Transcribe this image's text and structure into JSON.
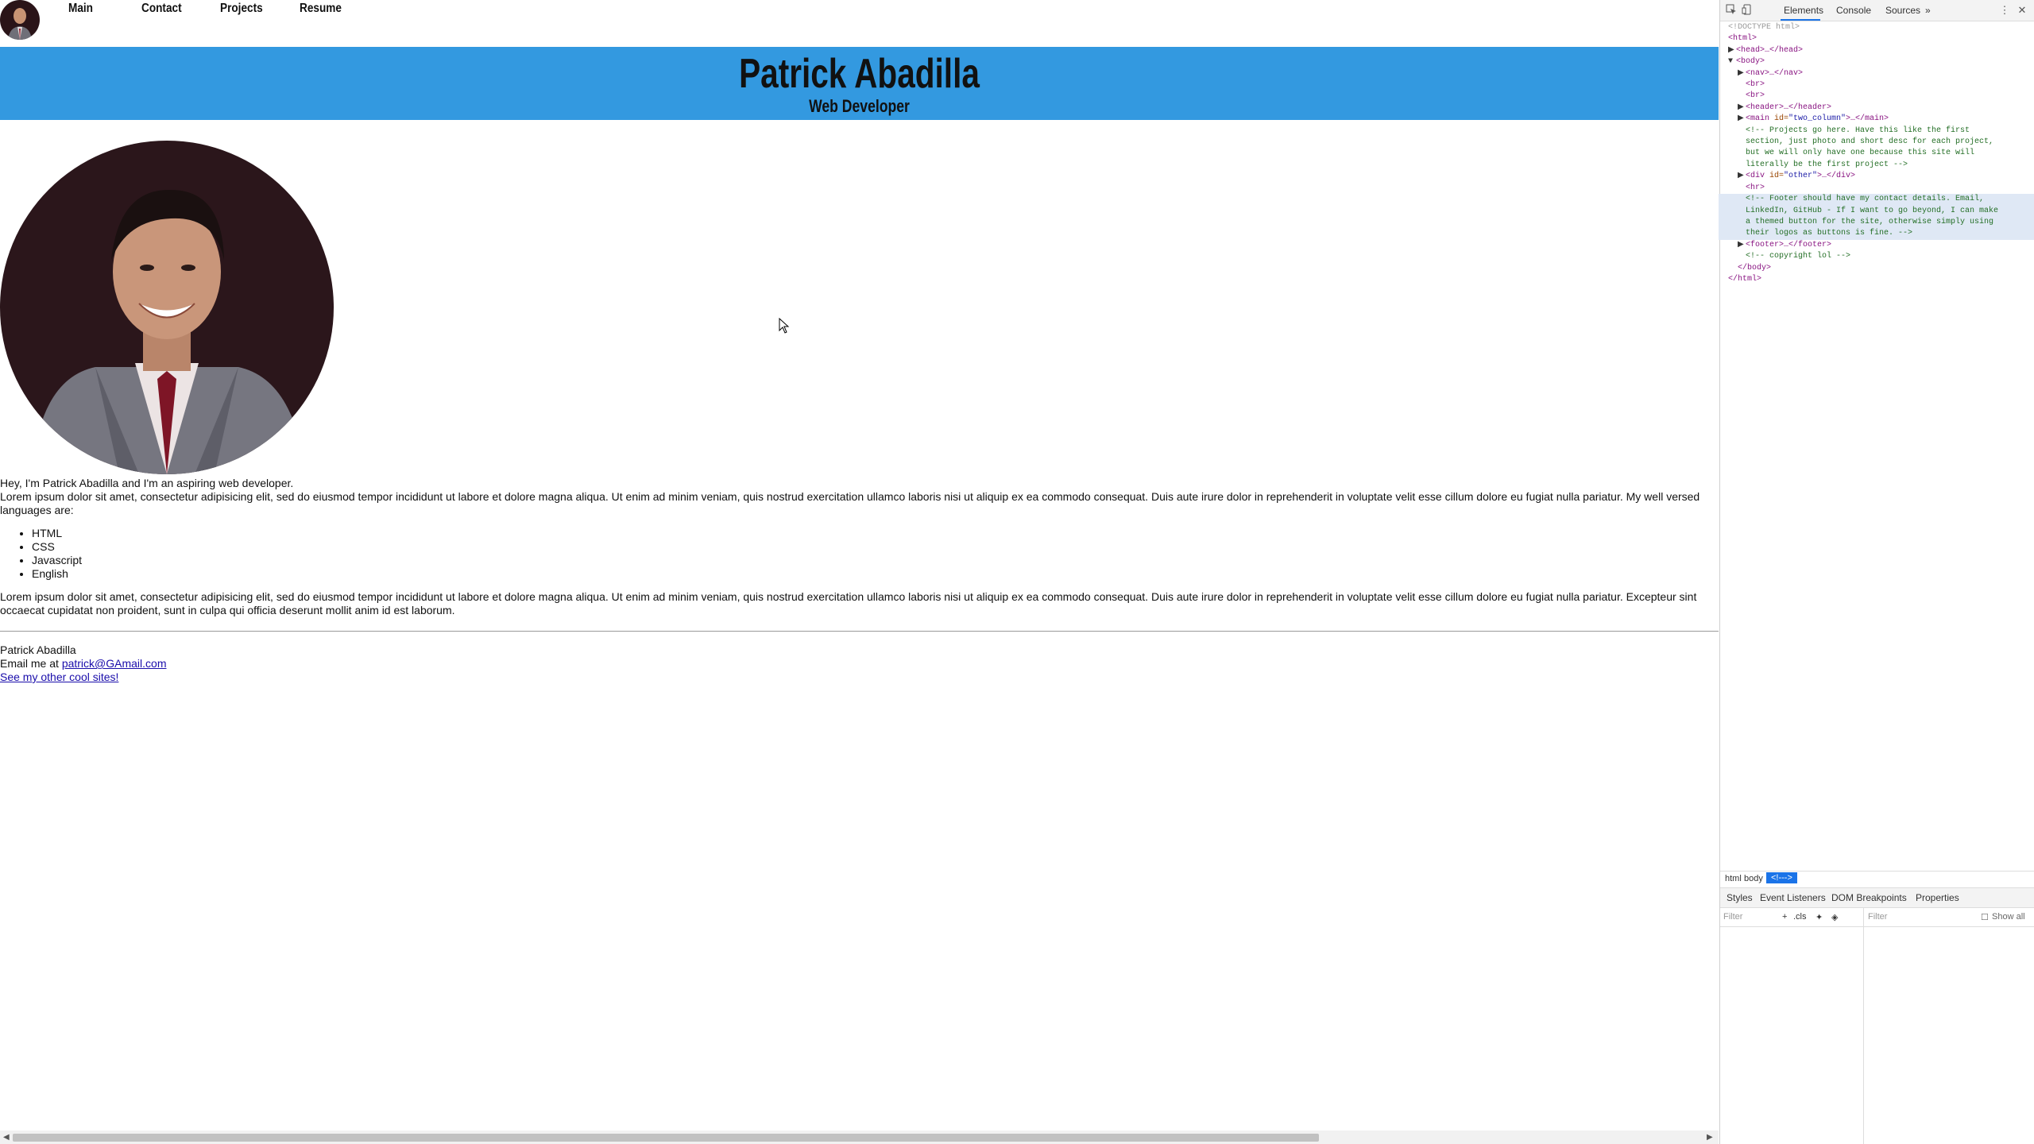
{
  "nav": {
    "links": [
      "Main",
      "Contact",
      "Projects",
      "Resume"
    ]
  },
  "header": {
    "title": "Patrick Abadilla",
    "subtitle": "Web Developer"
  },
  "intro": {
    "greeting": "Hey, I'm Patrick Abadilla and I'm an aspiring web developer.",
    "paragraph1": "Lorem ipsum dolor sit amet, consectetur adipisicing elit, sed do eiusmod tempor incididunt ut labore et dolore magna aliqua. Ut enim ad minim veniam, quis nostrud exercitation ullamco laboris nisi ut aliquip ex ea commodo consequat. Duis aute irure dolor in reprehenderit in voluptate velit esse cillum dolore eu fugiat nulla pariatur. My well versed languages are:",
    "languages": [
      "HTML",
      "CSS",
      "Javascript",
      "English"
    ],
    "paragraph2": "Lorem ipsum dolor sit amet, consectetur adipisicing elit, sed do eiusmod tempor incididunt ut labore et dolore magna aliqua. Ut enim ad minim veniam, quis nostrud exercitation ullamco laboris nisi ut aliquip ex ea commodo consequat. Duis aute irure dolor in reprehenderit in voluptate velit esse cillum dolore eu fugiat nulla pariatur. Excepteur sint occaecat cupidatat non proident, sunt in culpa qui officia deserunt mollit anim id est laborum."
  },
  "footer": {
    "name": "Patrick Abadilla",
    "email_prefix": "Email me at ",
    "email": "patrick@GAmail.com",
    "other_sites": "See my other cool sites!"
  },
  "devtools": {
    "tabs": [
      "Elements",
      "Console",
      "Sources",
      "»"
    ],
    "dom": {
      "doctype": "<!DOCTYPE html>",
      "html_open": "<html>",
      "head": "<head>…</head>",
      "body_open": "<body>",
      "nav": "<nav>…</nav>",
      "br": "<br>",
      "header": "<header>…</header>",
      "main_open": "<main ",
      "main_attr": "id=",
      "main_val": "\"two_column\"",
      "main_close": ">…</main>",
      "comment1": "<!-- Projects go here. Have this like the first\nsection, just photo and short desc for each project,\nbut we will only have one because this site will\nliterally be the first project -->",
      "div_open": "<div ",
      "div_attr": "id=",
      "div_val": "\"other\"",
      "div_close": ">…</div>",
      "hr": "<hr>",
      "comment2": "<!-- Footer should have my contact details. Email,\nLinkedIn, GitHub - If I want to go beyond, I can make\na themed button for the site, otherwise simply using\ntheir logos as buttons is fine. -->",
      "footer": "<footer>…</footer>",
      "comment3": "<!-- copyright lol -->",
      "body_close": "</body>",
      "html_close": "</html>"
    },
    "breadcrumbs": [
      "html",
      "body",
      "<!--->"
    ],
    "subtabs": [
      "Styles",
      "Event Listeners",
      "DOM Breakpoints",
      "Properties"
    ],
    "filter_placeholder": "Filter",
    "cls_label": ".cls",
    "filter2_placeholder": "Filter",
    "show_all_label": "Show all"
  }
}
